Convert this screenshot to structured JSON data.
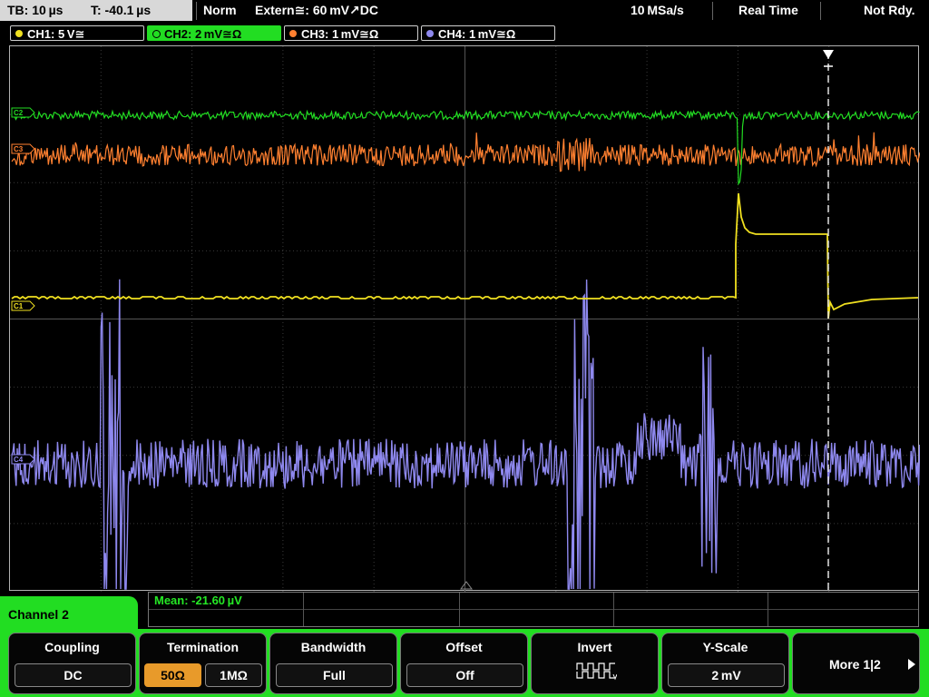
{
  "status_bar": {
    "timebase": "TB: 10 µs",
    "trigger_time": "T: -40.1 µs",
    "trigger_mode": "Norm",
    "trigger_source": "Extern≅: 60 mV↗DC",
    "sample_rate": "10 MSa/s",
    "acquisition_mode": "Real Time",
    "trigger_status": "Not Rdy."
  },
  "channels": [
    {
      "label": "CH1: 5 V≅",
      "color": "#f0e020",
      "marker": "C1"
    },
    {
      "label": "CH2: 2 mV≅Ω",
      "color": "#22dd22",
      "marker": "C2"
    },
    {
      "label": "CH3: 1 mV≅Ω",
      "color": "#ff8030",
      "marker": "C3"
    },
    {
      "label": "CH4: 1 mV≅Ω",
      "color": "#8e88ee",
      "marker": "C4"
    }
  ],
  "measurement": {
    "label": "Mean: -21.60 µV"
  },
  "channel_tab": {
    "label": "Channel 2"
  },
  "softkeys": {
    "coupling": {
      "title": "Coupling",
      "value": "DC"
    },
    "termination": {
      "title": "Termination",
      "options": [
        "50Ω",
        "1MΩ"
      ],
      "selected": 0
    },
    "bandwidth": {
      "title": "Bandwidth",
      "value": "Full"
    },
    "offset": {
      "title": "Offset",
      "value": "Off"
    },
    "invert": {
      "title": "Invert",
      "icon": "invert-waveform-icon"
    },
    "yscale": {
      "title": "Y-Scale",
      "value": "2 mV"
    },
    "more": {
      "label": "More 1|2",
      "icon": "arrow-right-icon"
    }
  },
  "colors": {
    "ch1": "#f0e020",
    "ch2": "#22dd22",
    "ch3": "#ff8030",
    "ch4": "#8e88ee",
    "softkey_bar": "#22dd22",
    "selected_option": "#e89a2a"
  }
}
